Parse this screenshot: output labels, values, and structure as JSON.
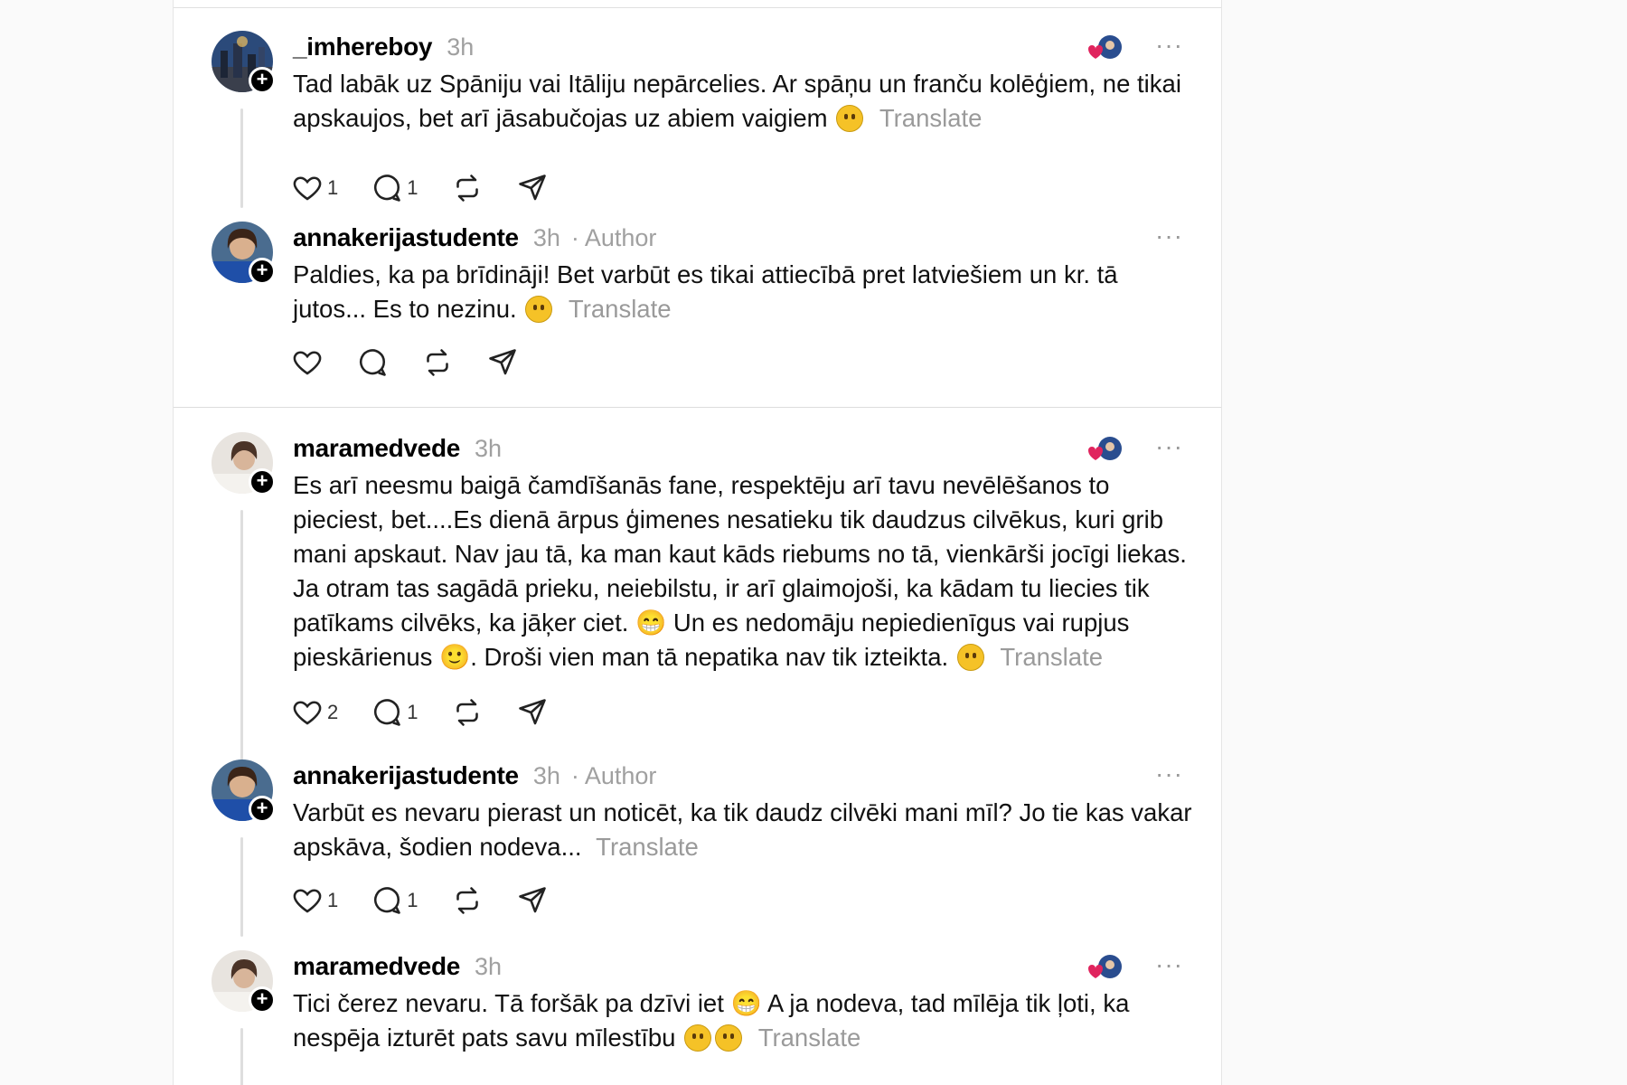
{
  "posts": [
    {
      "username": "_imhereboy",
      "time": "3h",
      "is_author": false,
      "author_label": "",
      "text": "Tad labāk uz Spāniju vai Itāliju nepārcelies. Ar spāņu un franču kolēģiem, ne tikai apskaujos, bet arī jāsabučojas uz abiem vaigiem",
      "translate": "Translate",
      "likes": "1",
      "replies": "1",
      "liked_by_author": true,
      "avatar": "city-photo"
    },
    {
      "username": "annakerijastudente",
      "time": "3h",
      "is_author": true,
      "author_label": "· Author",
      "text": "Paldies, ka pa brīdināji! Bet varbūt es tikai attiecībā pret latviešiem un kr. tā jutos... Es to nezinu.",
      "translate": "Translate",
      "likes": "",
      "replies": "",
      "liked_by_author": false,
      "avatar": "woman-photo"
    },
    {
      "username": "maramedvede",
      "time": "3h",
      "is_author": false,
      "author_label": "",
      "text": "Es arī neesmu baigā čamdīšanās fane, respektēju arī tavu nevēlēšanos to pieciest, bet....Es dienā ārpus ģimenes nesatieku tik daudzus cilvēkus, kuri grib mani apskaut. Nav jau tā, ka man kaut kāds riebums no tā, vienkārši jocīgi liekas. Ja otram tas sagādā prieku, neiebilstu, ir arī glaimojoši, ka kādam tu liecies tik patīkams cilvēks, ka jāķer ciet. 😁 Un es nedomāju nepiedienīgus vai rupjus pieskārienus 🙂. Droši vien man tā nepatika nav tik izteikta.",
      "translate": "Translate",
      "likes": "2",
      "replies": "1",
      "liked_by_author": true,
      "avatar": "woman2-photo"
    },
    {
      "username": "annakerijastudente",
      "time": "3h",
      "is_author": true,
      "author_label": "· Author",
      "text": "Varbūt es nevaru pierast un noticēt, ka tik daudz cilvēki mani mīl? Jo tie kas vakar apskāva, šodien nodeva...",
      "translate": "Translate",
      "likes": "1",
      "replies": "1",
      "liked_by_author": false,
      "avatar": "woman-photo"
    },
    {
      "username": "maramedvede",
      "time": "3h",
      "is_author": false,
      "author_label": "",
      "text": "Tici čerez nevaru. Tā foršāk pa dzīvi iet 😁 A ja nodeva, tad mīlēja tik ļoti, ka nespēja izturēt pats savu mīlestību",
      "translate": "Translate",
      "likes": "",
      "replies": "",
      "liked_by_author": true,
      "avatar": "woman2-photo"
    }
  ],
  "more_label": "···",
  "colors": {
    "accent": "#000000",
    "muted": "#a0a0a0",
    "like_heart": "#e0245e"
  }
}
